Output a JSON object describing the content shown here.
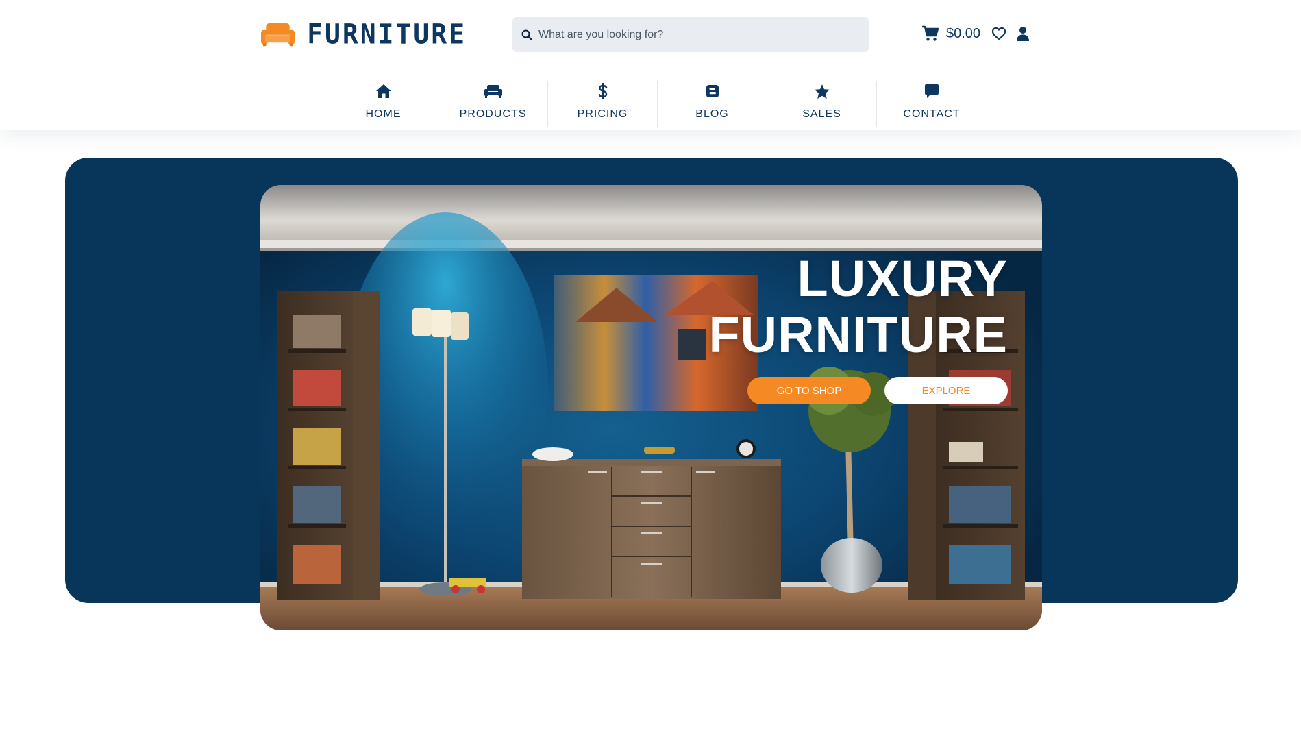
{
  "brand": {
    "name": "FURNITURE",
    "accent_color": "#f58a25",
    "primary_color": "#0d3660"
  },
  "search": {
    "placeholder": "What are you looking for?",
    "icon": "search-icon"
  },
  "header_actions": {
    "cart_icon": "cart-icon",
    "cart_total": "$0.00",
    "wishlist_icon": "heart-icon",
    "account_icon": "user-icon"
  },
  "nav": {
    "items": [
      {
        "label": "HOME",
        "icon": "home-icon"
      },
      {
        "label": "PRODUCTS",
        "icon": "sofa-icon"
      },
      {
        "label": "PRICING",
        "icon": "dollar-icon"
      },
      {
        "label": "BLOG",
        "icon": "blog-icon"
      },
      {
        "label": "SALES",
        "icon": "star-icon"
      },
      {
        "label": "CONTACT",
        "icon": "comment-icon"
      }
    ]
  },
  "hero": {
    "title_line1": "LUXURY",
    "title_line2": "FURNITURE",
    "primary_button": "GO TO SHOP",
    "secondary_button": "EXPLORE",
    "background_color": "#07365a"
  }
}
